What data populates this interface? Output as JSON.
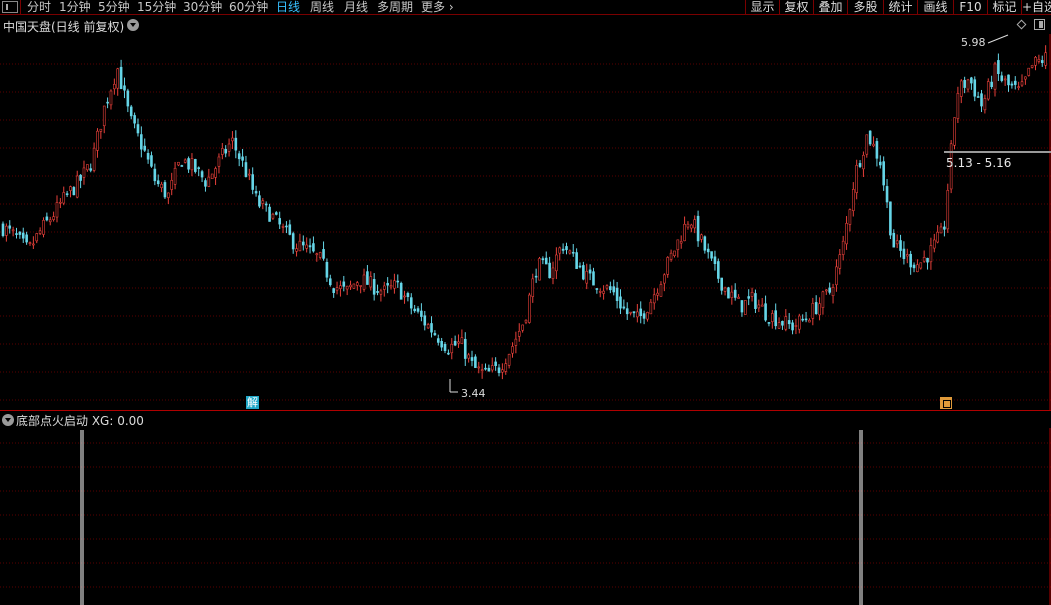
{
  "toolbar": {
    "periods": [
      "分时",
      "1分钟",
      "5分钟",
      "15分钟",
      "30分钟",
      "60分钟",
      "日线",
      "周线",
      "月线",
      "多周期",
      "更多"
    ],
    "active_period": "日线",
    "buttons": [
      "显示",
      "复权",
      "叠加",
      "多股",
      "统计",
      "画线",
      "F10",
      "标记",
      "+自选"
    ]
  },
  "main_chart": {
    "title": "中国天盘(日线 前复权)",
    "high_label": "5.98",
    "low_label": "3.44",
    "range_label": "5.13 - 5.16",
    "jie_badge": "解",
    "icons": [
      "diamond-icon",
      "window-restore-icon",
      "back-icon",
      "chevron-down-icon"
    ]
  },
  "indicator": {
    "title": "底部点火启动 XG: 0.00"
  },
  "colors": {
    "up": "#e8403a",
    "down": "#66d6e8",
    "grid": "#5a0000",
    "active_tab": "#37c0ff",
    "signal": "#ffffff",
    "background": "#000000"
  },
  "chart_data": {
    "type": "candlestick",
    "period": "日线",
    "adjustment": "前复权",
    "y_high": 5.98,
    "y_low": 3.44,
    "close_trace": [
      4.62,
      4.55,
      4.45,
      4.6,
      4.72,
      4.85,
      4.95,
      5.1,
      5.5,
      5.78,
      5.4,
      5.2,
      4.95,
      4.85,
      5.12,
      5.05,
      4.95,
      5.1,
      5.25,
      5.05,
      4.8,
      4.72,
      4.6,
      4.5,
      4.45,
      4.38,
      4.2,
      4.15,
      4.25,
      4.2,
      4.15,
      4.2,
      4.05,
      3.95,
      3.85,
      3.75,
      3.78,
      3.6,
      3.55,
      3.6,
      3.75,
      3.95,
      4.35,
      4.3,
      4.5,
      4.38,
      4.25,
      4.2,
      4.15,
      4.0,
      3.95,
      4.1,
      4.3,
      4.5,
      4.7,
      4.5,
      4.3,
      4.15,
      4.05,
      4.1,
      4.0,
      3.95,
      3.9,
      3.95,
      4.05,
      4.15,
      4.45,
      5.0,
      5.3,
      5.1,
      4.5,
      4.4,
      4.35,
      4.45,
      4.6,
      5.6,
      5.7,
      5.5,
      5.75,
      5.65,
      5.6,
      5.8,
      5.85
    ],
    "signals": [
      "底部点火启动",
      "底部点火启动"
    ]
  }
}
